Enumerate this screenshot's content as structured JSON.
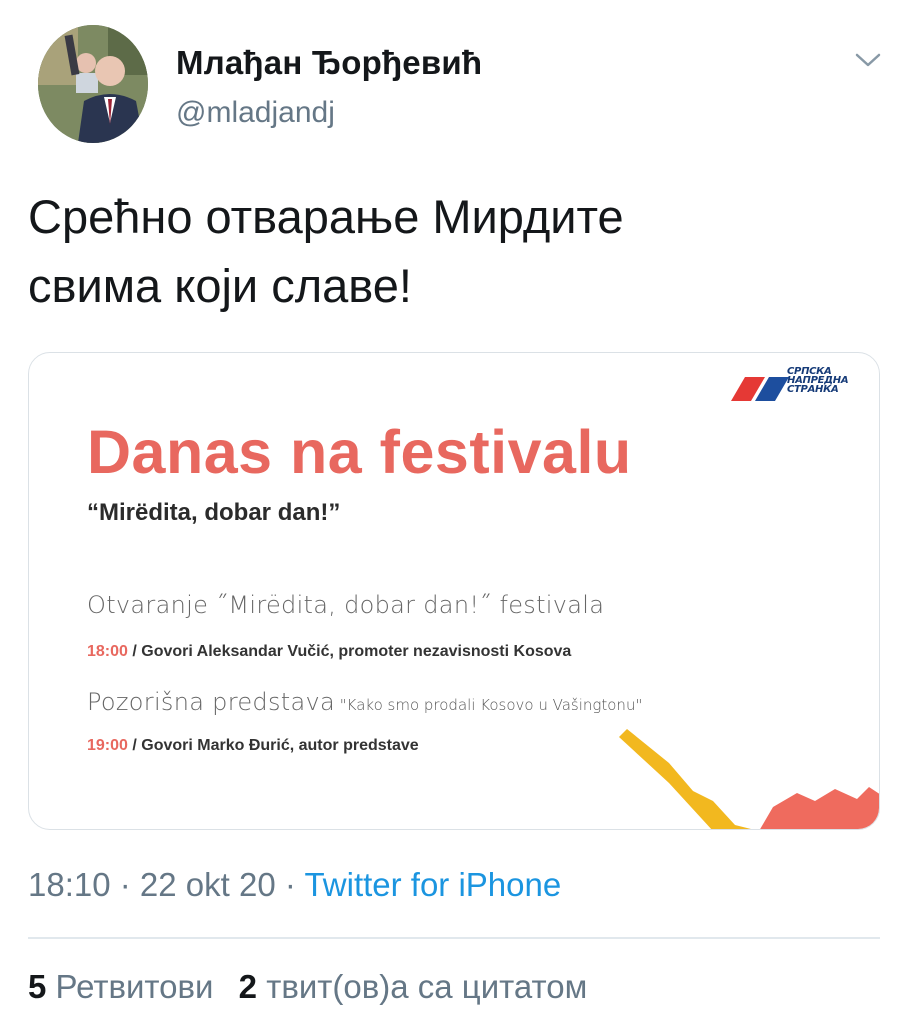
{
  "author": {
    "name": "Млађан Ђорђевић",
    "handle": "@mladjandj"
  },
  "icons": {
    "avatar": "avatar-photo",
    "more": "chevron-down-icon",
    "party_logo": "sns-flag-logo"
  },
  "tweet": {
    "line1": "Срећно отварање Мирдите",
    "line2": "свима који славе!"
  },
  "card": {
    "logo_lines": [
      "СРПСКА",
      "НАПРЕДНА",
      "СТРАНКА"
    ],
    "title": "Danas na festivalu",
    "subtitle": "“Mirëdita, dobar dan!”",
    "events": [
      {
        "title": "Otvaranje ˝Mirëdita, dobar dan!˝ festivala",
        "quote": "",
        "time": "18:00",
        "detail": " / Govori Aleksandar Vučić, promoter nezavisnosti Kosova"
      },
      {
        "title": "Pozorišna predstava",
        "quote": " \"Kako smo prodali Kosovo u Vašingtonu\"",
        "time": "19:00",
        "detail": " / Govori Marko Đurić, autor predstave"
      }
    ],
    "colors": {
      "title": "#e8685f",
      "red": "#e53935",
      "blue": "#1d4e9e",
      "yellow": "#f2b81f"
    }
  },
  "meta": {
    "time": "18:10",
    "sep1": " · ",
    "date": "22 okt 20",
    "sep2": " · ",
    "source": "Twitter for iPhone"
  },
  "stats": {
    "retweets_count": "5",
    "retweets_label": " Ретвитови",
    "quotes_count": "2",
    "quotes_label": " твит(ов)а са цитатом"
  },
  "colors": {
    "text": "#14171a",
    "secondary": "#657786",
    "link": "#1b95e0"
  }
}
